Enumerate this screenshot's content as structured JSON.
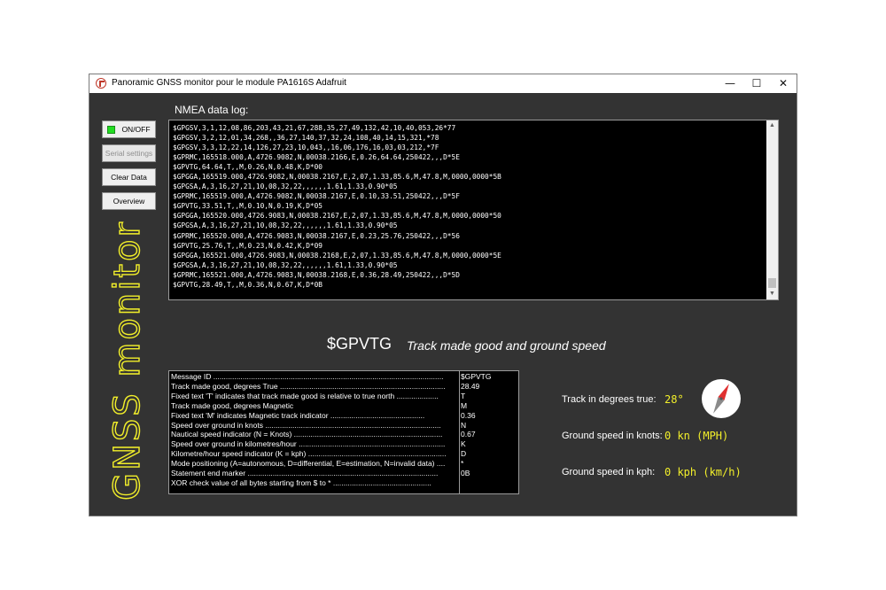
{
  "window": {
    "title": "Panoramic GNSS monitor pour le module PA1616S Adafruit",
    "controls": {
      "minimize": "—",
      "maximize": "☐",
      "close": "✕"
    }
  },
  "sidebar": {
    "on_off_label": "ON/OFF",
    "serial_settings_label": "Serial settings",
    "clear_data_label": "Clear Data",
    "overview_label": "Overview",
    "app_title": "GNSS monitor"
  },
  "log": {
    "label": "NMEA data log:",
    "lines": [
      "$GPGSV,3,1,12,08,86,203,43,21,67,288,35,27,49,132,42,10,40,053,26*77",
      "$GPGSV,3,2,12,01,34,268,,36,27,140,37,32,24,108,40,14,15,321,*78",
      "$GPGSV,3,3,12,22,14,126,27,23,10,043,,16,06,176,16,03,03,212,*7F",
      "$GPRMC,165518.000,A,4726.9082,N,00038.2166,E,0.26,64.64,250422,,,D*5E",
      "$GPVTG,64.64,T,,M,0.26,N,0.48,K,D*00",
      "$GPGGA,165519.000,4726.9082,N,00038.2167,E,2,07,1.33,85.6,M,47.8,M,0000,0000*5B",
      "$GPGSA,A,3,16,27,21,10,08,32,22,,,,,,1.61,1.33,0.90*05",
      "$GPRMC,165519.000,A,4726.9082,N,00038.2167,E,0.10,33.51,250422,,,D*5F",
      "$GPVTG,33.51,T,,M,0.10,N,0.19,K,D*05",
      "$GPGGA,165520.000,4726.9083,N,00038.2167,E,2,07,1.33,85.6,M,47.8,M,0000,0000*50",
      "$GPGSA,A,3,16,27,21,10,08,32,22,,,,,,1.61,1.33,0.90*05",
      "$GPRMC,165520.000,A,4726.9083,N,00038.2167,E,0.23,25.76,250422,,,D*56",
      "$GPVTG,25.76,T,,M,0.23,N,0.42,K,D*09",
      "$GPGGA,165521.000,4726.9083,N,00038.2168,E,2,07,1.33,85.6,M,47.8,M,0000,0000*5E",
      "$GPGSA,A,3,16,27,21,10,08,32,22,,,,,,1.61,1.33,0.90*05",
      "$GPRMC,165521.000,A,4726.9083,N,00038.2168,E,0.36,28.49,250422,,,D*5D",
      "$GPVTG,28.49,T,,M,0.36,N,0.67,K,D*0B"
    ]
  },
  "message": {
    "id": "$GPVTG",
    "description": "Track made good and ground speed"
  },
  "table": {
    "rows": [
      {
        "field": "Message ID ..............................................................................................................",
        "value": "$GPVTG"
      },
      {
        "field": "Track made good, degrees True ...............................................................................",
        "value": "28.49"
      },
      {
        "field": "Fixed text 'T' indicates that track made good is relative to true north ....................",
        "value": "T"
      },
      {
        "field": "Track made good, degrees Magnetic",
        "value": ""
      },
      {
        "field": "Fixed text 'M' indicates Magnetic track indicator .............................................",
        "value": "M"
      },
      {
        "field": "Speed over ground in knots ....................................................................................",
        "value": "0.36"
      },
      {
        "field": "Nautical speed indicator (N = Knots) .......................................................................",
        "value": "N"
      },
      {
        "field": "Speed over ground in kilometres/hour ......................................................................",
        "value": "0.67"
      },
      {
        "field": "Kilometre/hour speed indicator (K = kph) ..................................................................",
        "value": "K"
      },
      {
        "field": "Mode positioning (A=autonomous, D=differential, E=estimation, N=invalid data) ....",
        "value": "D"
      },
      {
        "field": "Statement end marker ...........................................................................................",
        "value": "*"
      },
      {
        "field": "XOR check value of all bytes starting from $ to * ...............................................",
        "value": "0B"
      }
    ]
  },
  "readouts": {
    "track_label": "Track in degrees true:",
    "track_value": "28°",
    "knots_label": "Ground speed in knots:",
    "knots_value": "0 kn (MPH)",
    "kph_label": "Ground speed in kph:",
    "kph_value": "0 kph (km/h)"
  },
  "compass": {
    "heading_deg": 28
  },
  "colors": {
    "accent": "#f2ef2a",
    "background": "#333333",
    "led_on": "#22dd22",
    "compass_needle_north": "#e03030"
  }
}
